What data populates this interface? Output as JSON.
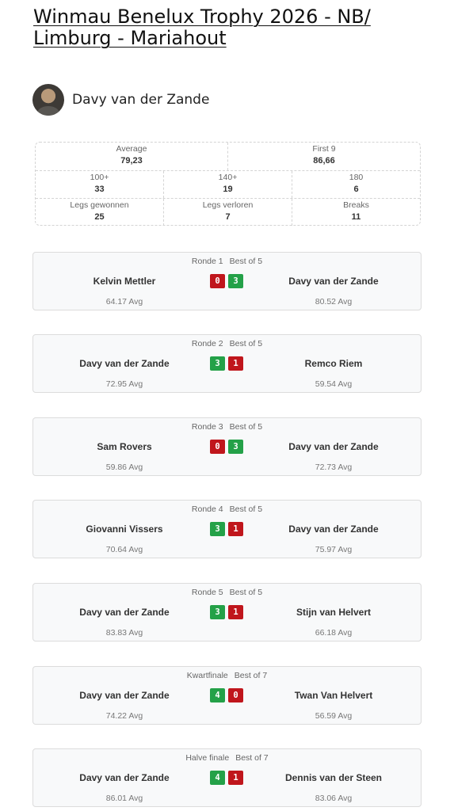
{
  "page": {
    "title": "Winmau Benelux Trophy 2026 - NB/ Limburg - Mariahout"
  },
  "player": {
    "name": "Davy van der Zande"
  },
  "stats": {
    "average": {
      "label": "Average",
      "value": "79,23"
    },
    "first9": {
      "label": "First 9",
      "value": "86,66"
    },
    "s100": {
      "label": "100+",
      "value": "33"
    },
    "s140": {
      "label": "140+",
      "value": "19"
    },
    "s180": {
      "label": "180",
      "value": "6"
    },
    "legs_won": {
      "label": "Legs gewonnen",
      "value": "25"
    },
    "legs_lost": {
      "label": "Legs verloren",
      "value": "7"
    },
    "breaks": {
      "label": "Breaks",
      "value": "11"
    }
  },
  "colors": {
    "win": "#24a148",
    "loss": "#c0161c"
  },
  "matches": [
    {
      "round": "Ronde 1",
      "format": "Best of 5",
      "left": "Kelvin Mettler",
      "left_score": "0",
      "right_score": "3",
      "right": "Davy van der Zande",
      "left_avg": "64.17 Avg",
      "right_avg": "80.52 Avg"
    },
    {
      "round": "Ronde 2",
      "format": "Best of 5",
      "left": "Davy van der Zande",
      "left_score": "3",
      "right_score": "1",
      "right": "Remco Riem",
      "left_avg": "72.95 Avg",
      "right_avg": "59.54 Avg"
    },
    {
      "round": "Ronde 3",
      "format": "Best of 5",
      "left": "Sam Rovers",
      "left_score": "0",
      "right_score": "3",
      "right": "Davy van der Zande",
      "left_avg": "59.86 Avg",
      "right_avg": "72.73 Avg"
    },
    {
      "round": "Ronde 4",
      "format": "Best of 5",
      "left": "Giovanni Vissers",
      "left_score": "3",
      "right_score": "1",
      "right": "Davy van der Zande",
      "left_avg": "70.64 Avg",
      "right_avg": "75.97 Avg"
    },
    {
      "round": "Ronde 5",
      "format": "Best of 5",
      "left": "Davy van der Zande",
      "left_score": "3",
      "right_score": "1",
      "right": "Stijn van Helvert",
      "left_avg": "83.83 Avg",
      "right_avg": "66.18 Avg"
    },
    {
      "round": "Kwartfinale",
      "format": "Best of 7",
      "left": "Davy van der Zande",
      "left_score": "4",
      "right_score": "0",
      "right": "Twan Van Helvert",
      "left_avg": "74.22 Avg",
      "right_avg": "56.59 Avg"
    },
    {
      "round": "Halve finale",
      "format": "Best of 7",
      "left": "Davy van der Zande",
      "left_score": "4",
      "right_score": "1",
      "right": "Dennis van der Steen",
      "left_avg": "86.01 Avg",
      "right_avg": "83.06 Avg"
    }
  ]
}
